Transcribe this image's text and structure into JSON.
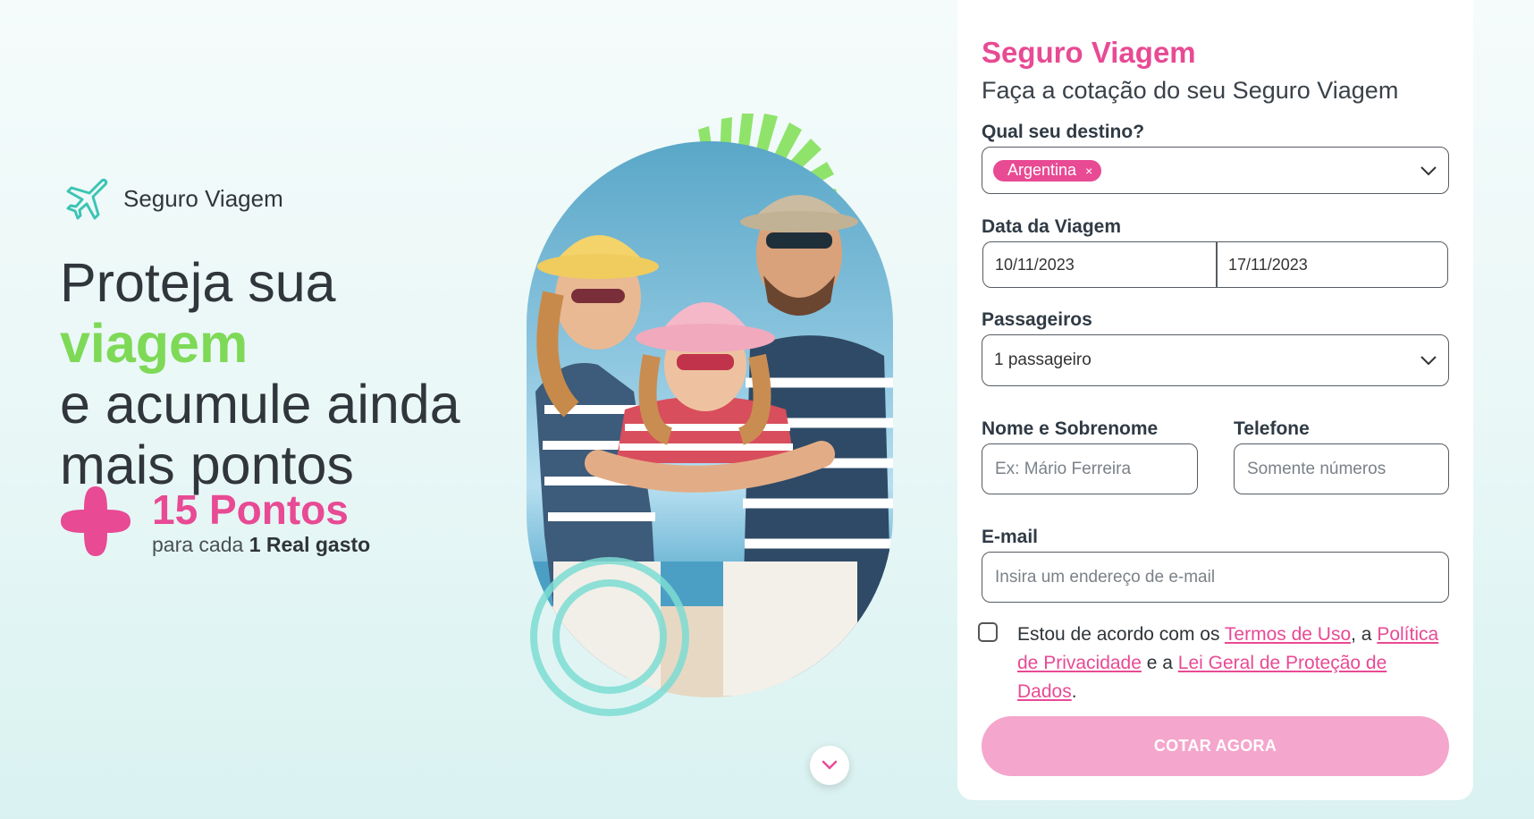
{
  "brand": {
    "name": "Seguro Viagem",
    "icon": "airplane-icon"
  },
  "hero": {
    "headline_pre": "Proteja sua ",
    "headline_highlight": "viagem",
    "headline_line2": "e acumule ainda",
    "headline_line3": "mais pontos"
  },
  "points": {
    "amount": "15 Pontos",
    "sub_pre": "para cada ",
    "sub_bold": "1 Real gasto",
    "icon": "plus-shape-icon"
  },
  "form": {
    "title": "Seguro Viagem",
    "subtitle": "Faça a cotação do seu Seguro Viagem",
    "destination": {
      "label": "Qual seu destino?",
      "chip": "Argentina",
      "chip_remove": "×"
    },
    "dates": {
      "label": "Data da Viagem",
      "start": "10/11/2023",
      "end": "17/11/2023"
    },
    "passengers": {
      "label": "Passageiros",
      "value": "1 passageiro"
    },
    "name": {
      "label": "Nome e Sobrenome",
      "placeholder": "Ex: Mário Ferreira"
    },
    "phone": {
      "label": "Telefone",
      "placeholder": "Somente números"
    },
    "email": {
      "label": "E-mail",
      "placeholder": "Insira um endereço de e-mail"
    },
    "consent": {
      "t1": "Estou de acordo com os ",
      "link1": "Termos de Uso",
      "t2": ", a ",
      "link2": "Política de Privacidade",
      "t3": " e a ",
      "link3": "Lei Geral de Proteção de Dados",
      "t4": "."
    },
    "submit": "COTAR AGORA"
  },
  "colors": {
    "accent": "#e84a94",
    "highlight": "#7ed957",
    "teal": "#4fd1c5"
  }
}
